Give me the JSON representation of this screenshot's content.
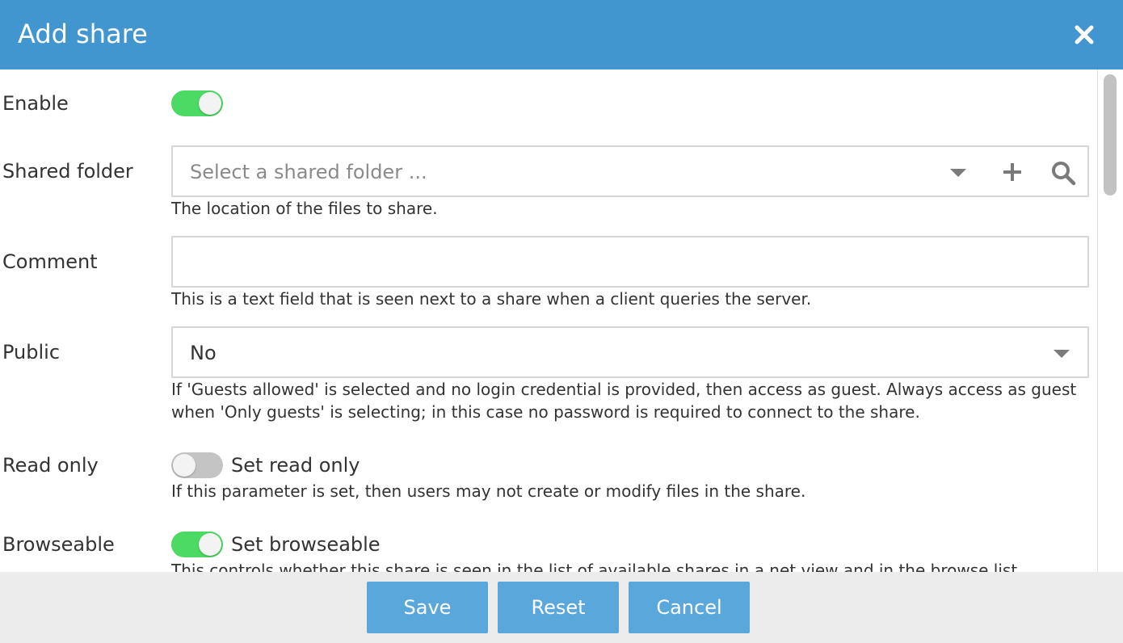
{
  "dialog": {
    "title": "Add share",
    "close_icon": "close-icon"
  },
  "form": {
    "enable": {
      "label": "Enable",
      "checked": true
    },
    "shared_folder": {
      "label": "Shared folder",
      "placeholder": "Select a shared folder ...",
      "help": "The location of the files to share.",
      "icons": [
        "chevron-down-icon",
        "plus-icon",
        "search-icon"
      ]
    },
    "comment": {
      "label": "Comment",
      "value": "",
      "help": "This is a text field that is seen next to a share when a client queries the server."
    },
    "public": {
      "label": "Public",
      "value": "No",
      "help": "If 'Guests allowed' is selected and no login credential is provided, then access as guest. Always access as guest when 'Only guests' is selecting; in this case no password is required to connect to the share."
    },
    "read_only": {
      "label": "Read only",
      "switch_label": "Set read only",
      "checked": false,
      "help": "If this parameter is set, then users may not create or modify files in the share."
    },
    "browseable": {
      "label": "Browseable",
      "switch_label": "Set browseable",
      "checked": true,
      "help": "This controls whether this share is seen in the list of available shares in a net view and in the browse list."
    }
  },
  "footer": {
    "save_label": "Save",
    "reset_label": "Reset",
    "cancel_label": "Cancel"
  },
  "colors": {
    "header_bg": "#4296cf",
    "toggle_on": "#4cd964",
    "toggle_off": "#c4c4c4",
    "button_bg": "#5aa7db",
    "footer_bg": "#ececec"
  }
}
